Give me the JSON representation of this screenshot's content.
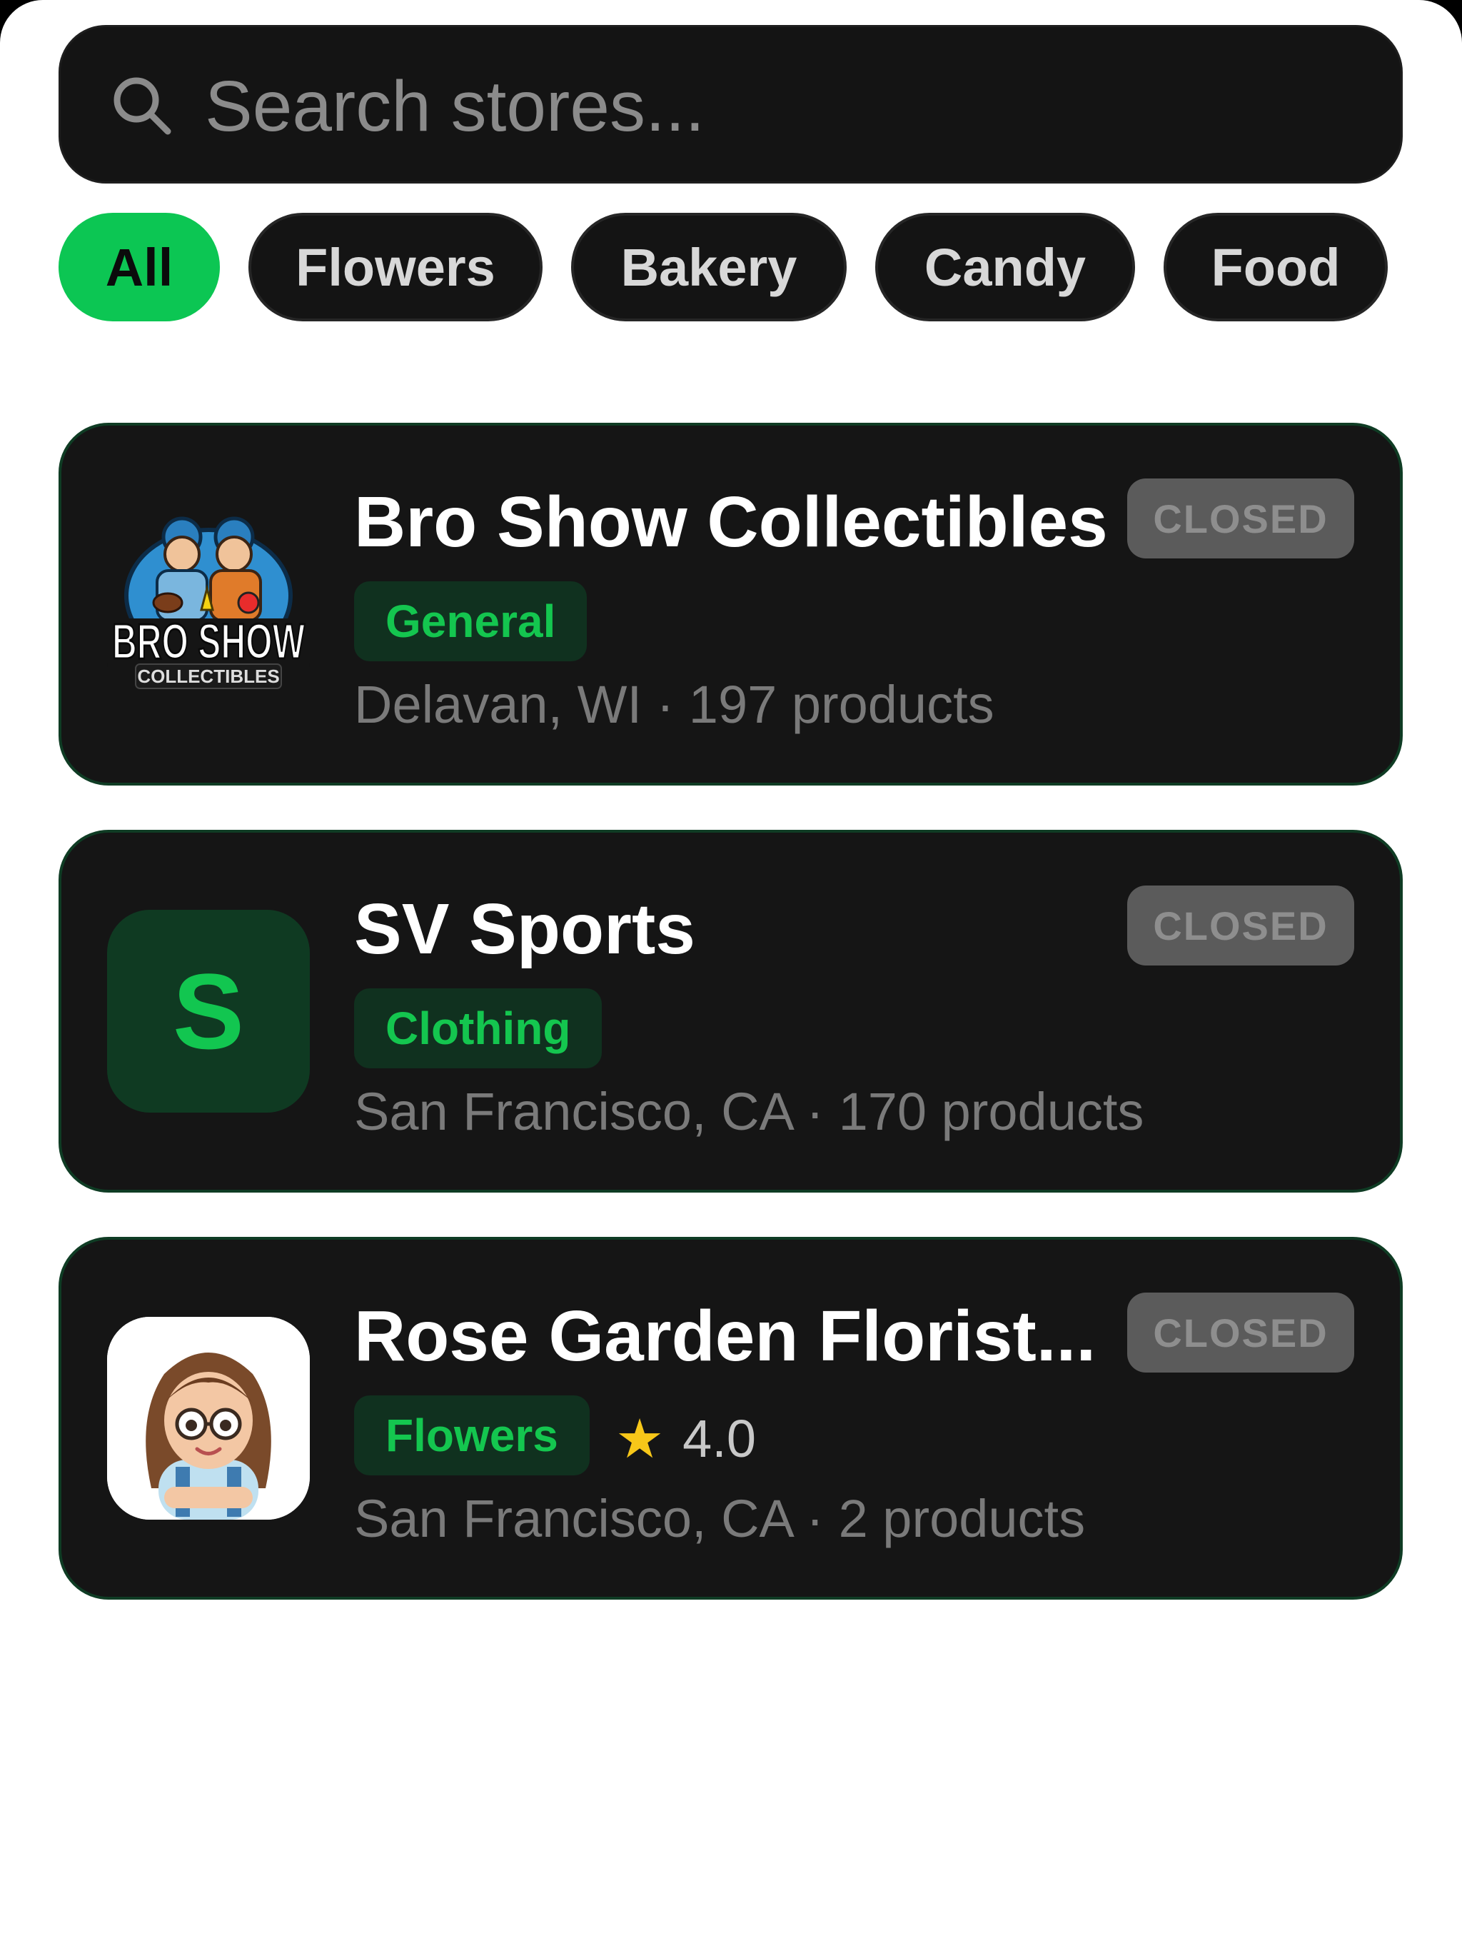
{
  "search": {
    "placeholder": "Search stores..."
  },
  "filters": [
    {
      "label": "All",
      "active": true
    },
    {
      "label": "Flowers",
      "active": false
    },
    {
      "label": "Bakery",
      "active": false
    },
    {
      "label": "Candy",
      "active": false
    },
    {
      "label": "Food",
      "active": false
    }
  ],
  "stores": [
    {
      "name": "Bro Show Collectibles",
      "status": "CLOSED",
      "category": "General",
      "meta": "Delavan, WI · 197 products",
      "logo_text": {
        "line1": "BRO SHOW",
        "line2": "COLLECTIBLES"
      }
    },
    {
      "name": "SV Sports",
      "status": "CLOSED",
      "category": "Clothing",
      "meta": "San Francisco, CA · 170 products",
      "logo_letter": "S"
    },
    {
      "name": "Rose Garden Florist...",
      "status": "CLOSED",
      "category": "Flowers",
      "rating": "4.0",
      "meta": "San Francisco, CA · 2 products"
    }
  ],
  "colors": {
    "accent": "#0cc653",
    "card_bg": "#151515",
    "tag_bg": "#10311f",
    "closed_badge": "#5b5b5b",
    "star": "#f7c719"
  },
  "icons": {
    "search": "search-icon",
    "rating": "star-icon"
  }
}
